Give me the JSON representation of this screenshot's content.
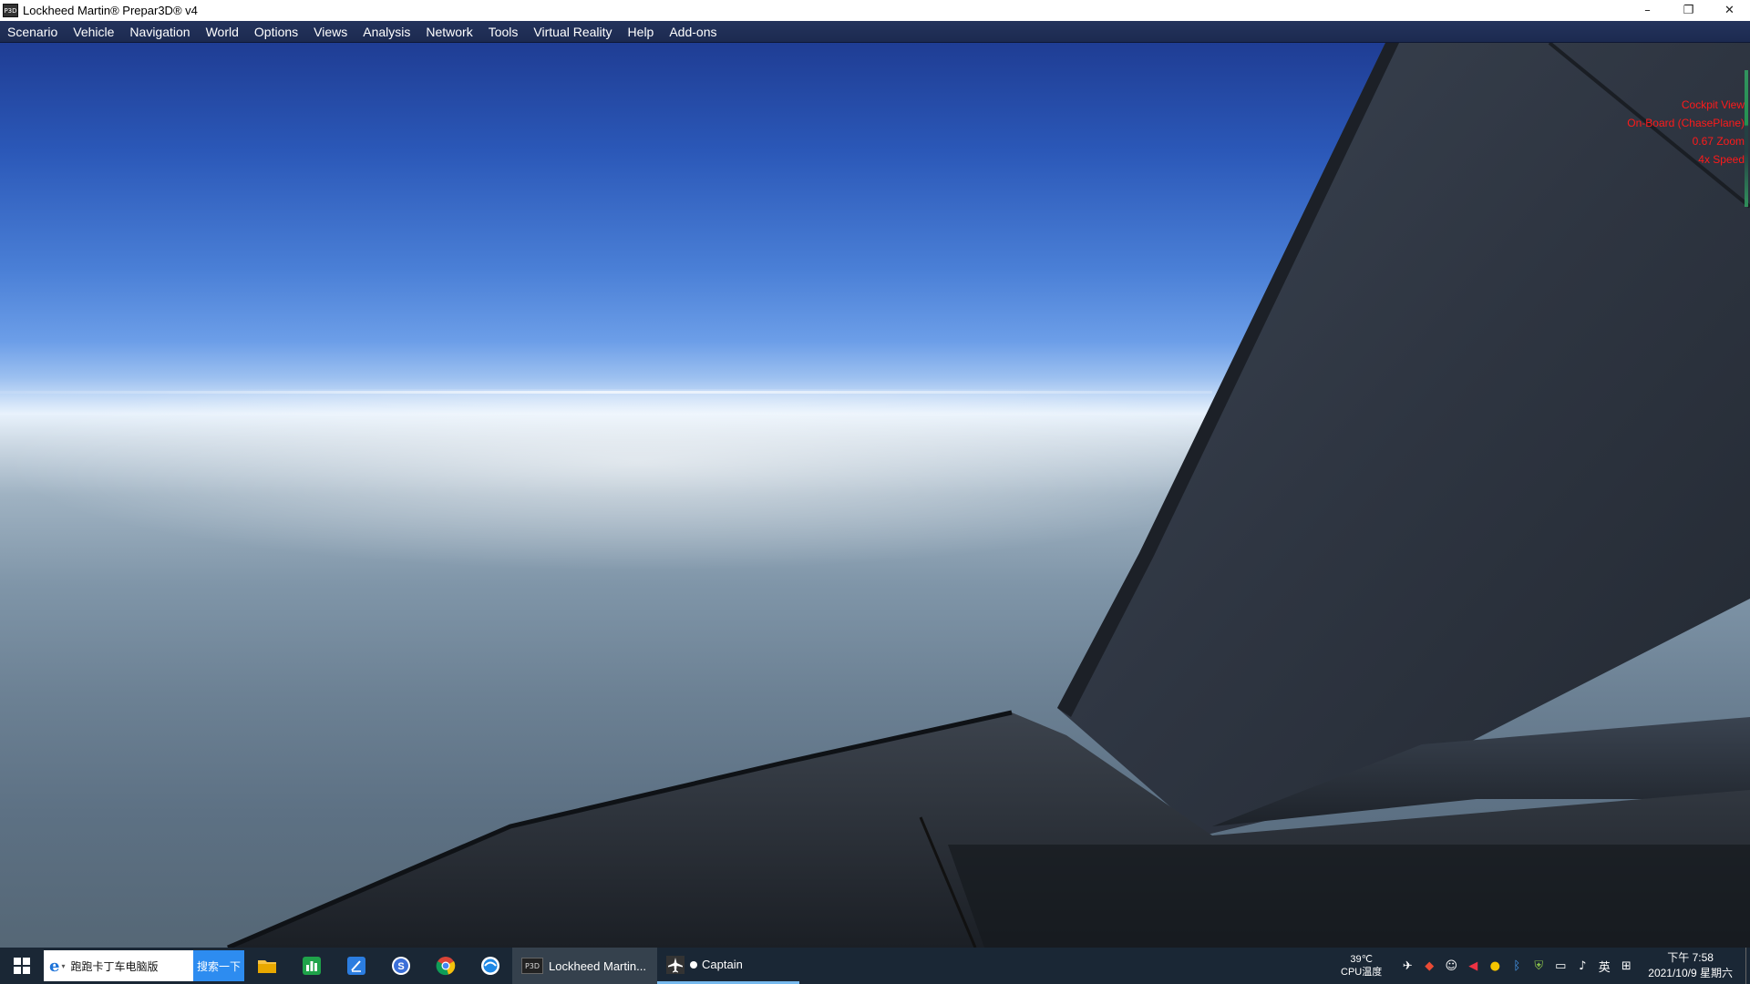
{
  "window": {
    "title": "Lockheed Martin® Prepar3D® v4",
    "app_icon_label": "P3D",
    "minimize": "–",
    "restore": "❐",
    "close": "✕"
  },
  "menu": [
    "Scenario",
    "Vehicle",
    "Navigation",
    "World",
    "Options",
    "Views",
    "Analysis",
    "Network",
    "Tools",
    "Virtual Reality",
    "Help",
    "Add-ons"
  ],
  "hud": {
    "view": "Cockpit View",
    "camera": "On-Board (ChasePlane)",
    "zoom": "0.67 Zoom",
    "speed": "4x Speed",
    "color": "#ff1a1a"
  },
  "taskbar": {
    "search_placeholder": "跑跑卡丁车电脑版",
    "search_button": "搜索一下",
    "apps": [
      {
        "name": "file-explorer-icon"
      },
      {
        "name": "spreadsheet-icon"
      },
      {
        "name": "editor-icon"
      },
      {
        "name": "sogou-icon"
      },
      {
        "name": "chrome-icon"
      },
      {
        "name": "browser-icon"
      }
    ],
    "active_app_label": "Lockheed Martin...",
    "p3d_badge": "P3D",
    "captain_label": "Captain",
    "cpu_temp": "39℃",
    "cpu_label": "CPU温度",
    "ime": "英",
    "time": "下午 7:58",
    "date": "2021/10/9 星期六"
  }
}
